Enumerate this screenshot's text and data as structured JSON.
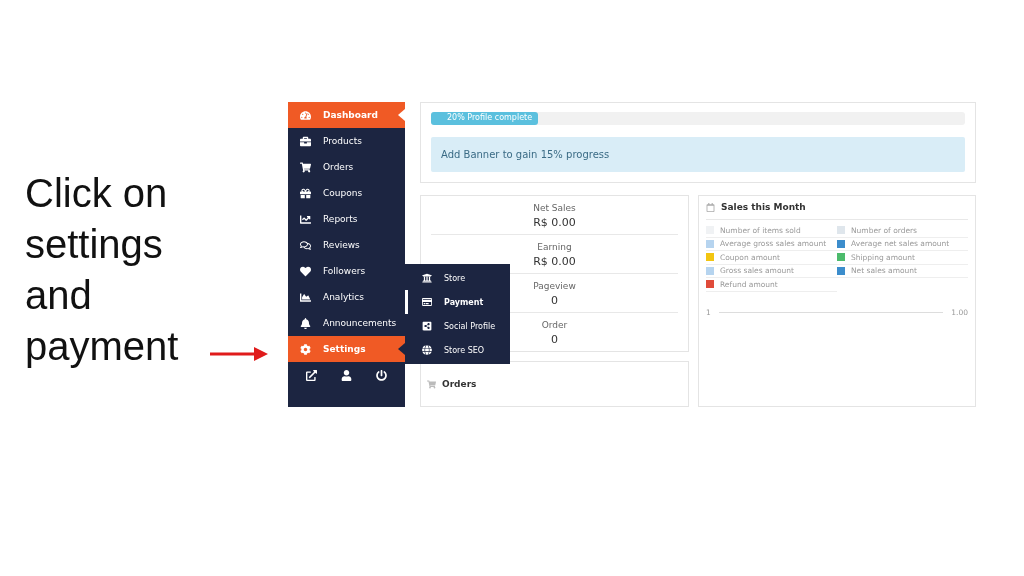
{
  "slide": {
    "caption": "Click on settings and payment"
  },
  "sidebar": {
    "items": [
      {
        "label": "Dashboard",
        "selected": true
      },
      {
        "label": "Products",
        "selected": false
      },
      {
        "label": "Orders",
        "selected": false
      },
      {
        "label": "Coupons",
        "selected": false
      },
      {
        "label": "Reports",
        "selected": false
      },
      {
        "label": "Reviews",
        "selected": false
      },
      {
        "label": "Followers",
        "selected": false
      },
      {
        "label": "Analytics",
        "selected": false
      },
      {
        "label": "Announcements",
        "selected": false
      },
      {
        "label": "Settings",
        "selected": true
      }
    ]
  },
  "settings_menu": {
    "items": [
      {
        "label": "Store",
        "selected": false
      },
      {
        "label": "Payment",
        "selected": true
      },
      {
        "label": "Social Profile",
        "selected": false
      },
      {
        "label": "Store SEO",
        "selected": false
      }
    ]
  },
  "profile": {
    "progress_label": "20% Profile complete",
    "level": 0.2,
    "tip": "Add Banner to gain 15% progress"
  },
  "stats": [
    {
      "label": "Net Sales",
      "value": "R$ 0.00"
    },
    {
      "label": "Earning",
      "value": "R$ 0.00"
    },
    {
      "label": "Pageview",
      "value": "0"
    },
    {
      "label": "Order",
      "value": "0"
    }
  ],
  "orders": {
    "title": "Orders"
  },
  "sales": {
    "title": "Sales this Month",
    "legend": [
      {
        "label": "Number of items sold",
        "color": "#f0f2f4"
      },
      {
        "label": "Number of orders",
        "color": "#dfe6ec"
      },
      {
        "label": "Average gross sales amount",
        "color": "#b6d4ef"
      },
      {
        "label": "Average net sales amount",
        "color": "#3c8dcc"
      },
      {
        "label": "Coupon amount",
        "color": "#f2c511"
      },
      {
        "label": "Shipping amount",
        "color": "#4cbb6c"
      },
      {
        "label": "Gross sales amount",
        "color": "#b6d4ef"
      },
      {
        "label": "Net sales amount",
        "color": "#3c8dcc"
      },
      {
        "label": "Refund amount",
        "color": "#e04b3a"
      }
    ],
    "axis_start": "1",
    "axis_end": "1.00"
  }
}
